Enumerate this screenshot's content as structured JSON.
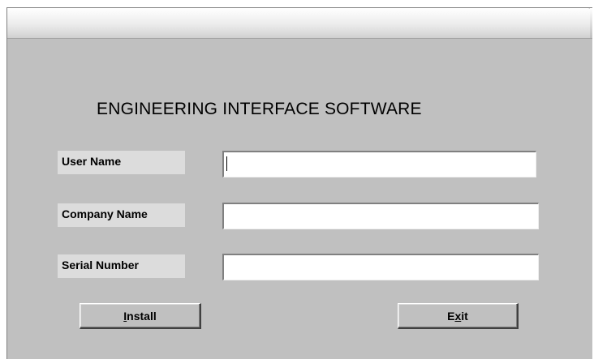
{
  "window": {
    "title_text": "",
    "colors": {
      "face": "#c0c0c0",
      "label_bg": "#dcdcdc",
      "input_bg": "#ffffff"
    }
  },
  "app": {
    "title": "ENGINEERING INTERFACE SOFTWARE"
  },
  "form": {
    "fields": [
      {
        "label": "User Name",
        "value": "",
        "focused": true
      },
      {
        "label": "Company Name",
        "value": "",
        "focused": false
      },
      {
        "label": "Serial Number",
        "value": "",
        "focused": false
      }
    ]
  },
  "buttons": {
    "install": {
      "mnemonic": "I",
      "rest": "nstall"
    },
    "exit": {
      "pre": "E",
      "mnemonic": "x",
      "post": "it"
    }
  }
}
